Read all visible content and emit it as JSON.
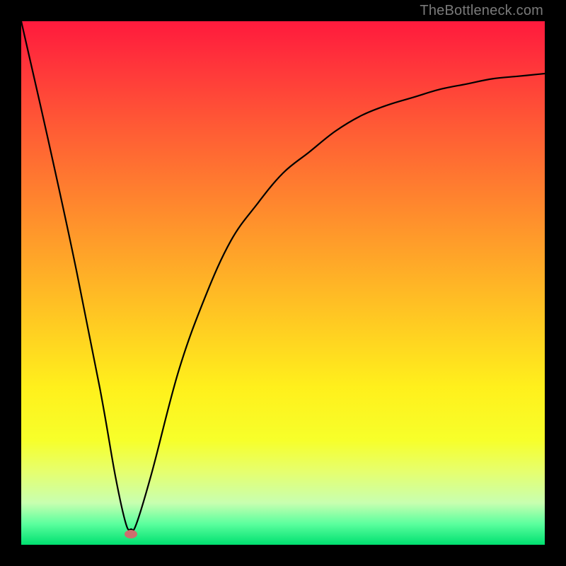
{
  "watermark": "TheBottleneck.com",
  "chart_data": {
    "type": "line",
    "title": "",
    "xlabel": "",
    "ylabel": "",
    "xlim": [
      0,
      100
    ],
    "ylim": [
      0,
      100
    ],
    "grid": false,
    "legend": false,
    "background": "rainbow-vertical-gradient",
    "series": [
      {
        "name": "bottleneck-curve",
        "x": [
          0,
          5,
          10,
          15,
          18,
          20,
          21,
          22,
          25,
          30,
          35,
          40,
          45,
          50,
          55,
          60,
          65,
          70,
          75,
          80,
          85,
          90,
          95,
          100
        ],
        "y": [
          100,
          78,
          55,
          30,
          13,
          4,
          3,
          4,
          14,
          33,
          47,
          58,
          65,
          71,
          75,
          79,
          82,
          84,
          85.5,
          87,
          88,
          89,
          89.5,
          90
        ]
      }
    ],
    "marker": {
      "x": 21,
      "y": 2,
      "color": "#cd6e6e",
      "shape": "ellipse"
    }
  }
}
